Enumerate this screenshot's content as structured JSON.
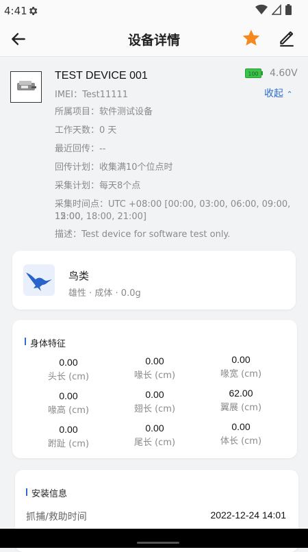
{
  "status": {
    "time": "4:41"
  },
  "appbar": {
    "title": "设备详情"
  },
  "device": {
    "name": "TEST DEVICE 001",
    "battery_label": "100",
    "voltage": "4.60V",
    "collapse_label": "收起",
    "info": [
      "IMEI：Test11111",
      "所属项目：软件测试设备",
      "工作天数：0 天",
      "最近回传：--",
      "回传计划：收集满10个位点时",
      "采集计划：每天8个点",
      "采集时间点：UTC +08:00 [00:00, 03:00, 06:00, 09:00, 12:00,",
      "15:00, 18:00, 21:00]",
      "描述：Test device for software test only."
    ]
  },
  "bird": {
    "name": "鸟类",
    "sub": "雄性 · 成体 · 0.0g"
  },
  "body": {
    "title": "身体特征",
    "stats": [
      {
        "value": "0.00",
        "label": "头长 (cm)"
      },
      {
        "value": "0.00",
        "label": "喙长 (cm)"
      },
      {
        "value": "0.00",
        "label": "喙宽 (cm)"
      },
      {
        "value": "0.00",
        "label": "喙高 (cm)"
      },
      {
        "value": "0.00",
        "label": "翅长 (cm)"
      },
      {
        "value": "62.00",
        "label": "翼展 (cm)"
      },
      {
        "value": "0.00",
        "label": "跗趾 (cm)"
      },
      {
        "value": "0.00",
        "label": "尾长 (cm)"
      },
      {
        "value": "0.00",
        "label": "体长 (cm)"
      }
    ]
  },
  "install": {
    "title": "安装信息",
    "capture_label": "抓捕/救助时间",
    "capture_value": "2022-12-24 14:01"
  },
  "colors": {
    "accent": "#2b6cd1",
    "star": "#f5891f",
    "battery": "#3cc34a"
  }
}
